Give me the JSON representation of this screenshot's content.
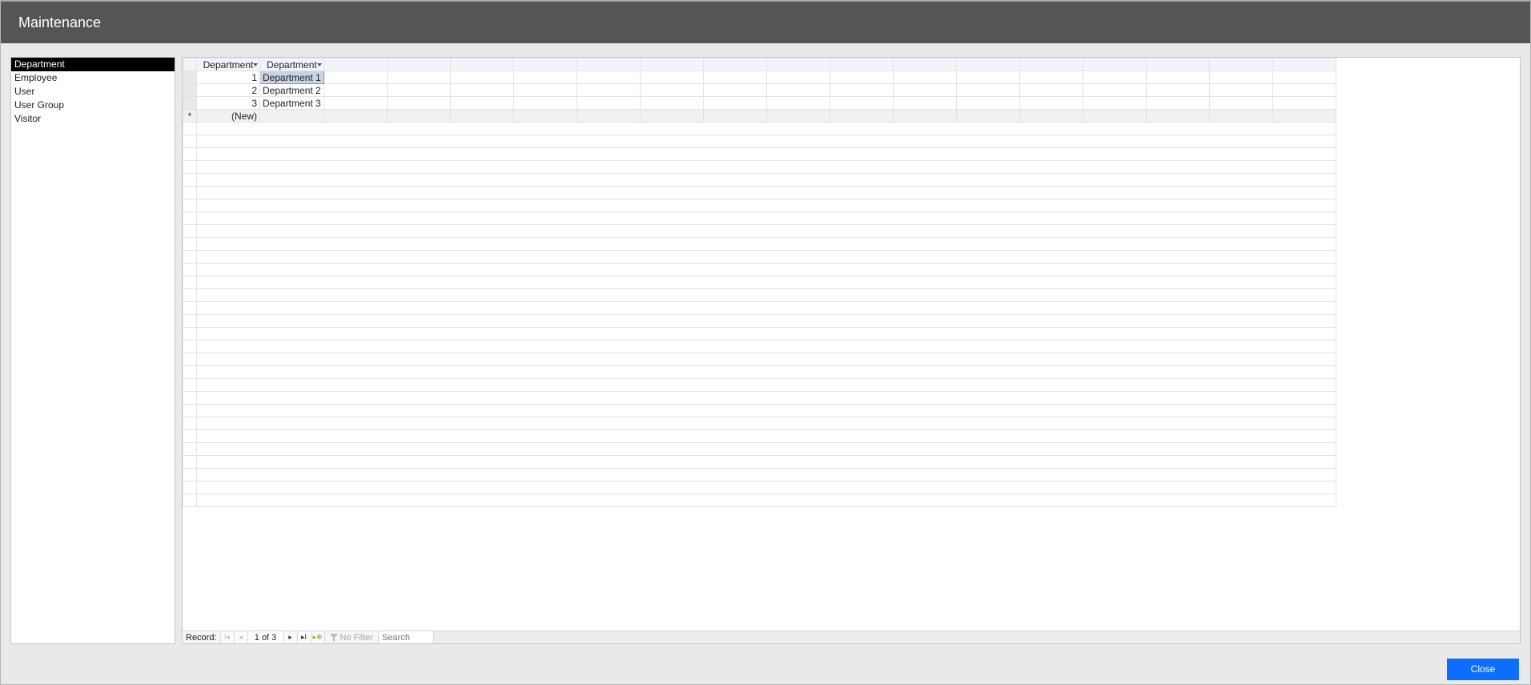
{
  "window": {
    "title": "Maintenance"
  },
  "sidebar": {
    "items": [
      {
        "label": "Department",
        "selected": true
      },
      {
        "label": "Employee",
        "selected": false
      },
      {
        "label": "User",
        "selected": false
      },
      {
        "label": "User Group",
        "selected": false
      },
      {
        "label": "Visitor",
        "selected": false
      }
    ]
  },
  "grid": {
    "columns": [
      "Department",
      "Department"
    ],
    "rows": [
      {
        "id": "1",
        "name": "Department 1",
        "selected": true
      },
      {
        "id": "2",
        "name": "Department 2",
        "selected": false
      },
      {
        "id": "3",
        "name": "Department 3",
        "selected": false
      }
    ],
    "new_row_label": "(New)",
    "new_row_marker": "*"
  },
  "nav": {
    "record_label": "Record:",
    "position_text": "1 of 3",
    "filter_label": "No Filter",
    "search_placeholder": "Search"
  },
  "footer": {
    "close_label": "Close"
  }
}
